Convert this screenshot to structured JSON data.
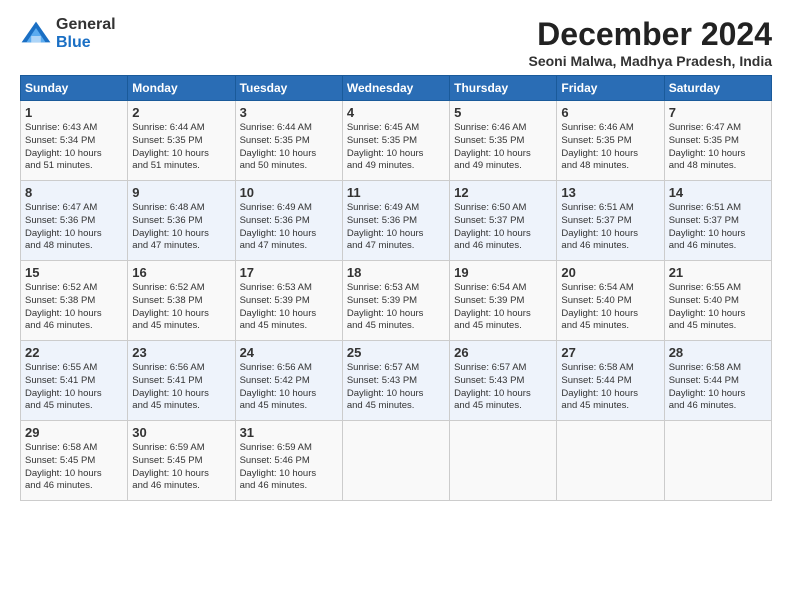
{
  "logo": {
    "general": "General",
    "blue": "Blue"
  },
  "title": "December 2024",
  "subtitle": "Seoni Malwa, Madhya Pradesh, India",
  "days_header": [
    "Sunday",
    "Monday",
    "Tuesday",
    "Wednesday",
    "Thursday",
    "Friday",
    "Saturday"
  ],
  "weeks": [
    [
      {
        "day": "1",
        "info": "Sunrise: 6:43 AM\nSunset: 5:34 PM\nDaylight: 10 hours\nand 51 minutes."
      },
      {
        "day": "2",
        "info": "Sunrise: 6:44 AM\nSunset: 5:35 PM\nDaylight: 10 hours\nand 51 minutes."
      },
      {
        "day": "3",
        "info": "Sunrise: 6:44 AM\nSunset: 5:35 PM\nDaylight: 10 hours\nand 50 minutes."
      },
      {
        "day": "4",
        "info": "Sunrise: 6:45 AM\nSunset: 5:35 PM\nDaylight: 10 hours\nand 49 minutes."
      },
      {
        "day": "5",
        "info": "Sunrise: 6:46 AM\nSunset: 5:35 PM\nDaylight: 10 hours\nand 49 minutes."
      },
      {
        "day": "6",
        "info": "Sunrise: 6:46 AM\nSunset: 5:35 PM\nDaylight: 10 hours\nand 48 minutes."
      },
      {
        "day": "7",
        "info": "Sunrise: 6:47 AM\nSunset: 5:35 PM\nDaylight: 10 hours\nand 48 minutes."
      }
    ],
    [
      {
        "day": "8",
        "info": "Sunrise: 6:47 AM\nSunset: 5:36 PM\nDaylight: 10 hours\nand 48 minutes."
      },
      {
        "day": "9",
        "info": "Sunrise: 6:48 AM\nSunset: 5:36 PM\nDaylight: 10 hours\nand 47 minutes."
      },
      {
        "day": "10",
        "info": "Sunrise: 6:49 AM\nSunset: 5:36 PM\nDaylight: 10 hours\nand 47 minutes."
      },
      {
        "day": "11",
        "info": "Sunrise: 6:49 AM\nSunset: 5:36 PM\nDaylight: 10 hours\nand 47 minutes."
      },
      {
        "day": "12",
        "info": "Sunrise: 6:50 AM\nSunset: 5:37 PM\nDaylight: 10 hours\nand 46 minutes."
      },
      {
        "day": "13",
        "info": "Sunrise: 6:51 AM\nSunset: 5:37 PM\nDaylight: 10 hours\nand 46 minutes."
      },
      {
        "day": "14",
        "info": "Sunrise: 6:51 AM\nSunset: 5:37 PM\nDaylight: 10 hours\nand 46 minutes."
      }
    ],
    [
      {
        "day": "15",
        "info": "Sunrise: 6:52 AM\nSunset: 5:38 PM\nDaylight: 10 hours\nand 46 minutes."
      },
      {
        "day": "16",
        "info": "Sunrise: 6:52 AM\nSunset: 5:38 PM\nDaylight: 10 hours\nand 45 minutes."
      },
      {
        "day": "17",
        "info": "Sunrise: 6:53 AM\nSunset: 5:39 PM\nDaylight: 10 hours\nand 45 minutes."
      },
      {
        "day": "18",
        "info": "Sunrise: 6:53 AM\nSunset: 5:39 PM\nDaylight: 10 hours\nand 45 minutes."
      },
      {
        "day": "19",
        "info": "Sunrise: 6:54 AM\nSunset: 5:39 PM\nDaylight: 10 hours\nand 45 minutes."
      },
      {
        "day": "20",
        "info": "Sunrise: 6:54 AM\nSunset: 5:40 PM\nDaylight: 10 hours\nand 45 minutes."
      },
      {
        "day": "21",
        "info": "Sunrise: 6:55 AM\nSunset: 5:40 PM\nDaylight: 10 hours\nand 45 minutes."
      }
    ],
    [
      {
        "day": "22",
        "info": "Sunrise: 6:55 AM\nSunset: 5:41 PM\nDaylight: 10 hours\nand 45 minutes."
      },
      {
        "day": "23",
        "info": "Sunrise: 6:56 AM\nSunset: 5:41 PM\nDaylight: 10 hours\nand 45 minutes."
      },
      {
        "day": "24",
        "info": "Sunrise: 6:56 AM\nSunset: 5:42 PM\nDaylight: 10 hours\nand 45 minutes."
      },
      {
        "day": "25",
        "info": "Sunrise: 6:57 AM\nSunset: 5:43 PM\nDaylight: 10 hours\nand 45 minutes."
      },
      {
        "day": "26",
        "info": "Sunrise: 6:57 AM\nSunset: 5:43 PM\nDaylight: 10 hours\nand 45 minutes."
      },
      {
        "day": "27",
        "info": "Sunrise: 6:58 AM\nSunset: 5:44 PM\nDaylight: 10 hours\nand 45 minutes."
      },
      {
        "day": "28",
        "info": "Sunrise: 6:58 AM\nSunset: 5:44 PM\nDaylight: 10 hours\nand 46 minutes."
      }
    ],
    [
      {
        "day": "29",
        "info": "Sunrise: 6:58 AM\nSunset: 5:45 PM\nDaylight: 10 hours\nand 46 minutes."
      },
      {
        "day": "30",
        "info": "Sunrise: 6:59 AM\nSunset: 5:45 PM\nDaylight: 10 hours\nand 46 minutes."
      },
      {
        "day": "31",
        "info": "Sunrise: 6:59 AM\nSunset: 5:46 PM\nDaylight: 10 hours\nand 46 minutes."
      },
      {
        "day": "",
        "info": ""
      },
      {
        "day": "",
        "info": ""
      },
      {
        "day": "",
        "info": ""
      },
      {
        "day": "",
        "info": ""
      }
    ]
  ]
}
